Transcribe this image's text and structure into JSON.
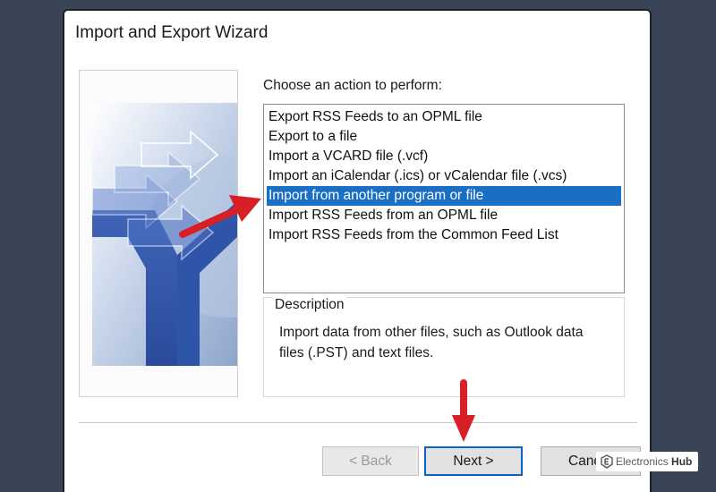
{
  "window": {
    "title": "Import and Export Wizard"
  },
  "prompt": "Choose an action to perform:",
  "actions": {
    "selected_index": 4,
    "items": [
      "Export RSS Feeds to an OPML file",
      "Export to a file",
      "Import a VCARD file (.vcf)",
      "Import an iCalendar (.ics) or vCalendar file (.vcs)",
      "Import from another program or file",
      "Import RSS Feeds from an OPML file",
      "Import RSS Feeds from the Common Feed List"
    ]
  },
  "description": {
    "legend": "Description",
    "text": "Import data from other files, such as Outlook data files (.PST) and text files."
  },
  "buttons": {
    "back": "< Back",
    "next": "Next >",
    "cancel": "Cance"
  },
  "watermark": {
    "brand": "Electronics",
    "brand_suffix": "Hub"
  },
  "colors": {
    "background": "#3a4457",
    "selection": "#1a6ec6",
    "annotation_arrow": "#d81f26",
    "default_button_border": "#0a64c8"
  },
  "icons": {
    "wizard_art": "import-export-arrows-icon",
    "annotation": "red-arrow-icon",
    "watermark_logo": "electronics-hub-logo-icon"
  }
}
